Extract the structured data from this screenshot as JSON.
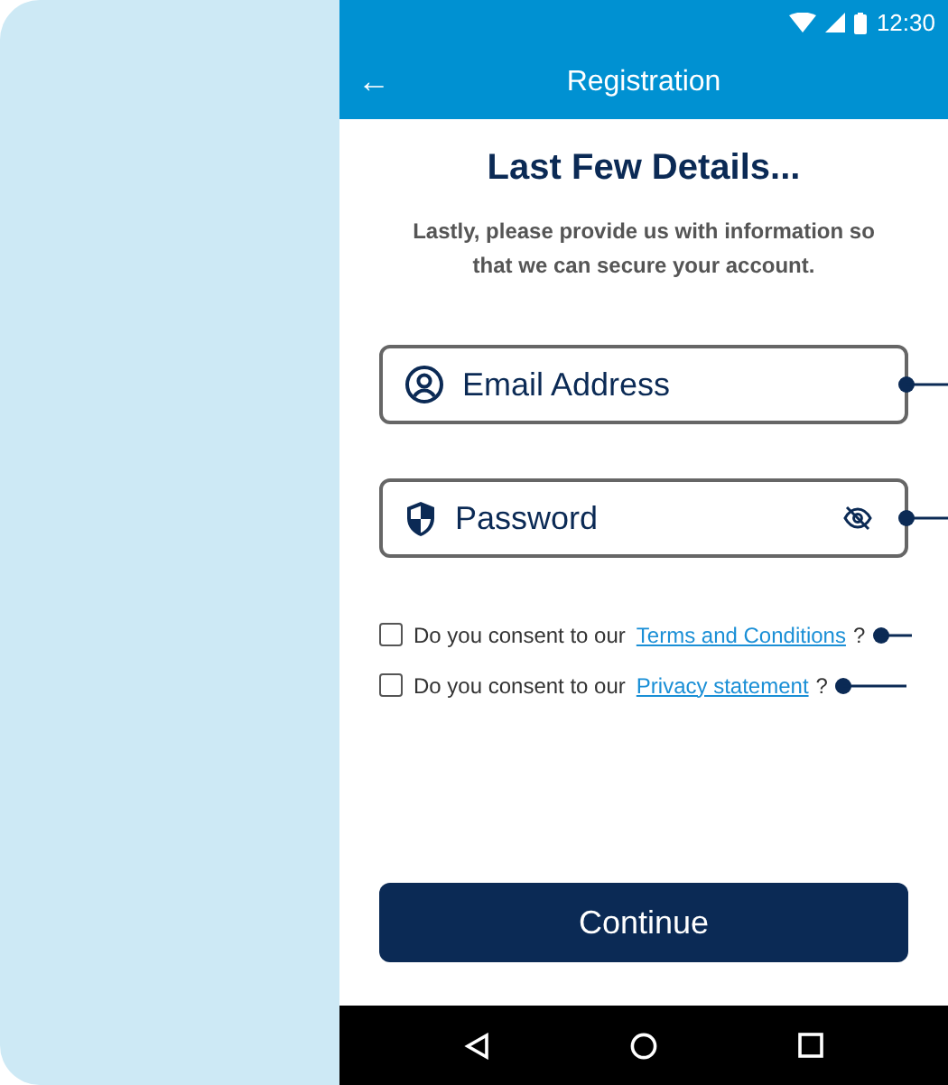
{
  "status_bar": {
    "time": "12:30"
  },
  "app_bar": {
    "back": "←",
    "title": "Registration"
  },
  "heading": "Last Few Details...",
  "intro": "Lastly, please provide us with information so that we can secure your account.",
  "fields": [
    {
      "kind": "email",
      "placeholder": "Email Address"
    },
    {
      "kind": "password",
      "placeholder": "Password"
    }
  ],
  "consents": [
    {
      "text": "Do you consent to our",
      "link": "Terms and Conditions",
      "suffix": "?",
      "checked": false
    },
    {
      "text": "Do you consent to our",
      "link": "Privacy statement",
      "suffix": "?",
      "checked": false
    }
  ],
  "continue_button": "Continue"
}
